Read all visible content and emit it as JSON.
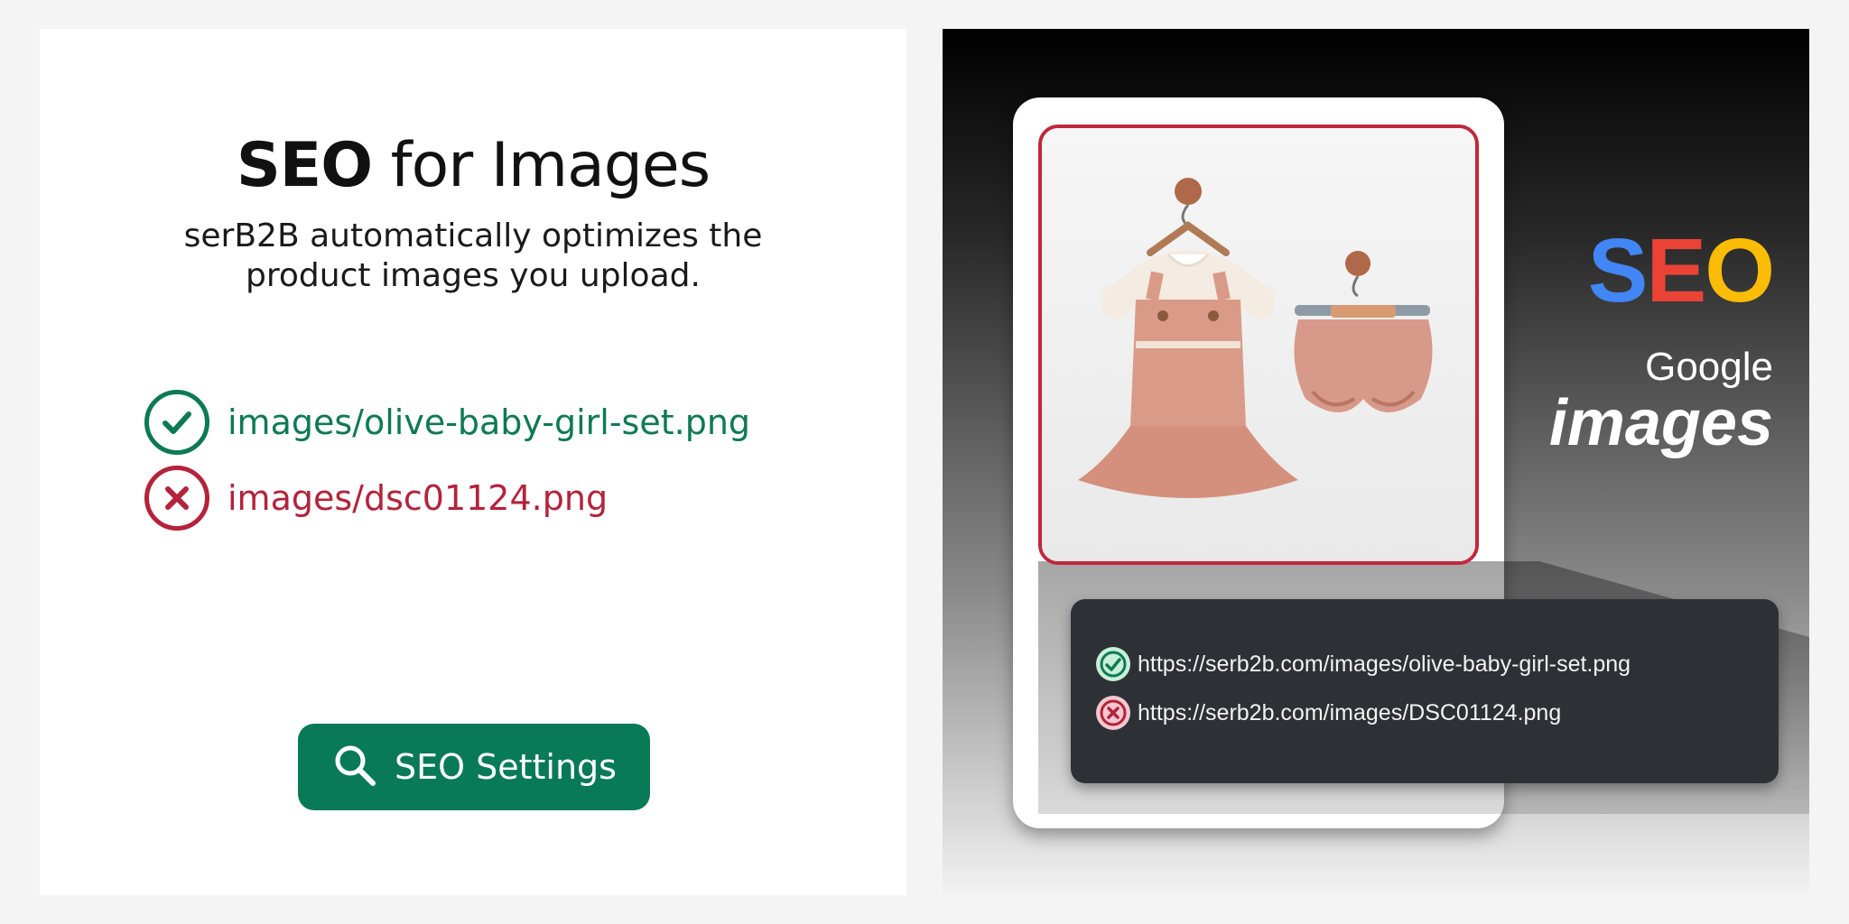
{
  "left": {
    "title_bold": "SEO",
    "title_rest": " for Images",
    "subtitle_line1": "serB2B automatically optimizes the",
    "subtitle_line2": "product images you upload.",
    "good_file": "images/olive-baby-girl-set.png",
    "bad_file": "images/dsc01124.png",
    "button_label": "SEO Settings"
  },
  "right": {
    "logo": {
      "s": "S",
      "e": "E",
      "o": "O"
    },
    "google": "Google",
    "images": "images",
    "good_url": "https://serb2b.com/images/olive-baby-girl-set.png",
    "bad_url": "https://serb2b.com/images/DSC01124.png"
  },
  "colors": {
    "success": "#0e7a55",
    "error": "#b3233b",
    "button": "#087a55",
    "logo_s": "#4285f4",
    "logo_e": "#ea4335",
    "logo_o": "#fbbc05"
  },
  "icons": [
    "check-circle-icon",
    "x-circle-icon",
    "search-icon"
  ]
}
